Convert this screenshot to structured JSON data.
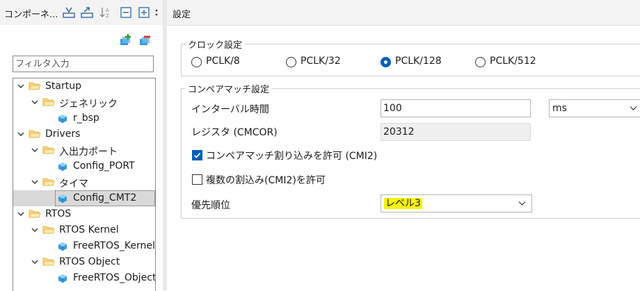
{
  "left_panel": {
    "title": "コンポーネ...",
    "filter_placeholder": "フィルタ入力",
    "tree": [
      {
        "label": "Startup",
        "depth": 0,
        "type": "folder",
        "expanded": true
      },
      {
        "label": "ジェネリック",
        "depth": 1,
        "type": "folder",
        "expanded": true
      },
      {
        "label": "r_bsp",
        "depth": 2,
        "type": "component"
      },
      {
        "label": "Drivers",
        "depth": 0,
        "type": "folder",
        "expanded": true
      },
      {
        "label": "入出力ポート",
        "depth": 1,
        "type": "folder",
        "expanded": true
      },
      {
        "label": "Config_PORT",
        "depth": 2,
        "type": "component"
      },
      {
        "label": "タイマ",
        "depth": 1,
        "type": "folder",
        "expanded": true
      },
      {
        "label": "Config_CMT2",
        "depth": 2,
        "type": "component",
        "selected": true
      },
      {
        "label": "RTOS",
        "depth": 0,
        "type": "folder",
        "expanded": true
      },
      {
        "label": "RTOS Kernel",
        "depth": 1,
        "type": "folder",
        "expanded": true
      },
      {
        "label": "FreeRTOS_Kernel",
        "depth": 2,
        "type": "component"
      },
      {
        "label": "RTOS Object",
        "depth": 1,
        "type": "folder",
        "expanded": true
      },
      {
        "label": "FreeRTOS_Object",
        "depth": 2,
        "type": "component"
      }
    ]
  },
  "right_panel": {
    "title": "設定",
    "clock_group": {
      "legend": "クロック設定",
      "options": [
        {
          "label": "PCLK/8",
          "checked": false
        },
        {
          "label": "PCLK/32",
          "checked": false
        },
        {
          "label": "PCLK/128",
          "checked": true
        },
        {
          "label": "PCLK/512",
          "checked": false
        }
      ]
    },
    "match_group": {
      "legend": "コンペアマッチ設定",
      "interval_label": "インターバル時間",
      "interval_value": "100",
      "interval_unit": "ms",
      "register_label": "レジスタ (CMCOR)",
      "register_value": "20312",
      "enable_cmi2_label": "コンペアマッチ割り込みを許可 (CMI2)",
      "enable_cmi2_checked": true,
      "multi_int_label": "複数の割込み(CMI2)を許可",
      "multi_int_checked": false,
      "priority_label": "優先順位",
      "priority_value": "レベル3"
    }
  },
  "colors": {
    "accent": "#005fb8",
    "highlight": "#f7f30a",
    "folder": "#e8b84a",
    "component": "#3a9ad9"
  }
}
